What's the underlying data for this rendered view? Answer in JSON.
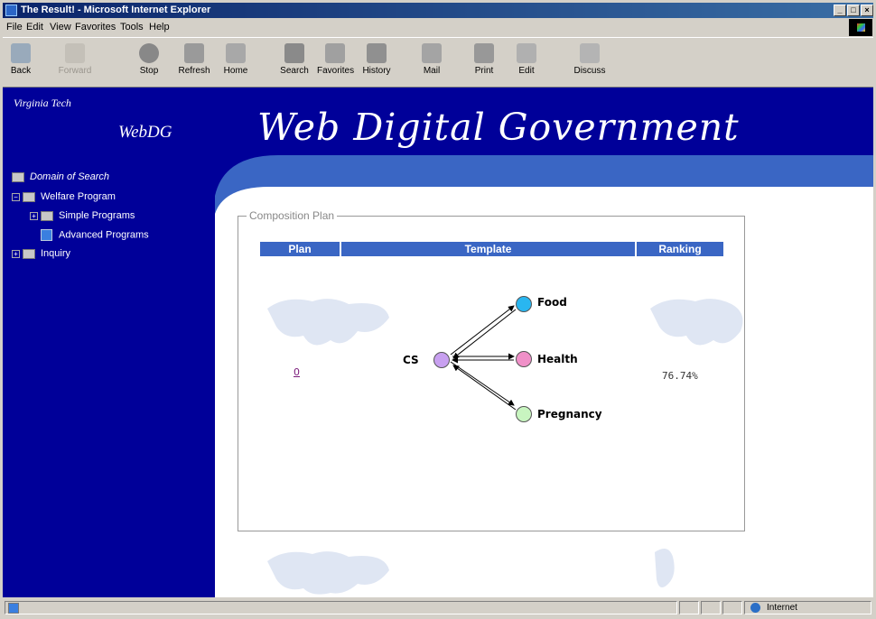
{
  "window": {
    "title": "The Result! - Microsoft Internet Explorer"
  },
  "menu": [
    "File",
    "Edit",
    "View",
    "Favorites",
    "Tools",
    "Help"
  ],
  "toolbar": [
    {
      "label": "Back",
      "icon": "back-arrow-icon"
    },
    {
      "label": "Forward",
      "icon": "forward-arrow-icon"
    },
    {
      "label": "Stop",
      "icon": "stop-icon"
    },
    {
      "label": "Refresh",
      "icon": "refresh-icon"
    },
    {
      "label": "Home",
      "icon": "home-icon"
    },
    {
      "label": "Search",
      "icon": "search-icon"
    },
    {
      "label": "Favorites",
      "icon": "favorites-icon"
    },
    {
      "label": "History",
      "icon": "history-icon"
    },
    {
      "label": "Mail",
      "icon": "mail-icon"
    },
    {
      "label": "Print",
      "icon": "print-icon"
    },
    {
      "label": "Edit",
      "icon": "edit-icon"
    },
    {
      "label": "Discuss",
      "icon": "discuss-icon"
    }
  ],
  "header": {
    "org": "Virginia Tech",
    "short": "WebDG",
    "title": "Web Digital Government"
  },
  "tree": {
    "root": "Domain of Search",
    "welfare": "Welfare Program",
    "simple": "Simple Programs",
    "advanced": "Advanced Programs",
    "inquiry": "Inquiry"
  },
  "panel": {
    "legend": "Composition Plan",
    "columns": [
      "Plan",
      "Template",
      "Ranking"
    ],
    "plan_link": "0",
    "ranking": "76.74%",
    "nodes": {
      "source": "CS",
      "targets": [
        "Food",
        "Health",
        "Pregnancy"
      ]
    }
  },
  "status": {
    "zone": "Internet"
  },
  "colors": {
    "page_blue": "#000099",
    "header_bar": "#3a66c4",
    "node_cs": "#c8a0f0",
    "node_food": "#29b6f0",
    "node_health": "#f090c8",
    "node_pregnancy": "#c8f5c0"
  }
}
